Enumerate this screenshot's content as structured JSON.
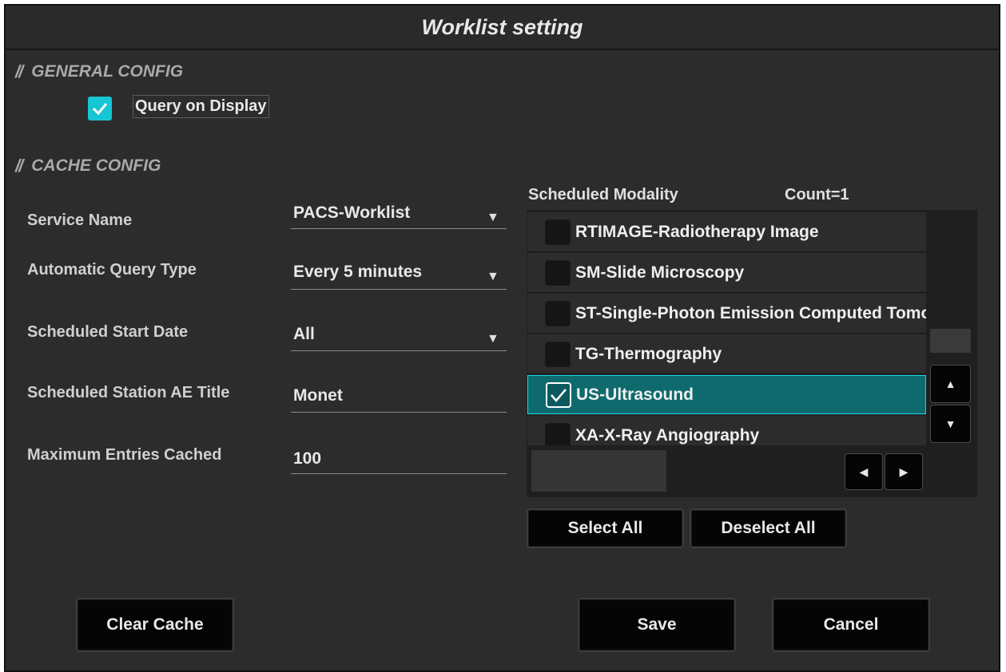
{
  "dialog": {
    "title": "Worklist setting"
  },
  "general": {
    "header": "GENERAL CONFIG",
    "query_on_display": {
      "label": "Query on Display",
      "checked": true
    }
  },
  "cache": {
    "header": "CACHE CONFIG",
    "fields": [
      {
        "label": "Service Name",
        "value": "PACS-Worklist",
        "type": "dropdown"
      },
      {
        "label": "Automatic Query Type",
        "value": "Every 5 minutes",
        "type": "dropdown"
      },
      {
        "label": "Scheduled Start Date",
        "value": "All",
        "type": "dropdown"
      },
      {
        "label": "Scheduled Station AE Title",
        "value": "Monet",
        "type": "text"
      },
      {
        "label": "Maximum Entries Cached",
        "value": "100",
        "type": "text"
      }
    ]
  },
  "modality": {
    "header": "Scheduled Modality",
    "count": "Count=1",
    "items": [
      {
        "label": "RTIMAGE-Radiotherapy Image",
        "checked": false
      },
      {
        "label": "SM-Slide Microscopy",
        "checked": false
      },
      {
        "label": "ST-Single-Photon Emission Computed Tomography",
        "checked": false
      },
      {
        "label": "TG-Thermography",
        "checked": false
      },
      {
        "label": "US-Ultrasound",
        "checked": true
      },
      {
        "label": "XA-X-Ray Angiography",
        "checked": false
      }
    ],
    "select_all": "Select All",
    "deselect_all": "Deselect All"
  },
  "footer": {
    "clear_cache": "Clear Cache",
    "save": "Save",
    "cancel": "Cancel"
  },
  "colors": {
    "accent": "#17c6d3",
    "selected_row": "#0f6a6e",
    "background": "#2c2c2c"
  },
  "icons": {
    "checkmark": "check-icon",
    "dropdown": "dropdown-arrow-icon",
    "scroll_up": "triangle-up-icon",
    "scroll_down": "triangle-down-icon",
    "scroll_left": "triangle-left-icon",
    "scroll_right": "triangle-right-icon"
  }
}
